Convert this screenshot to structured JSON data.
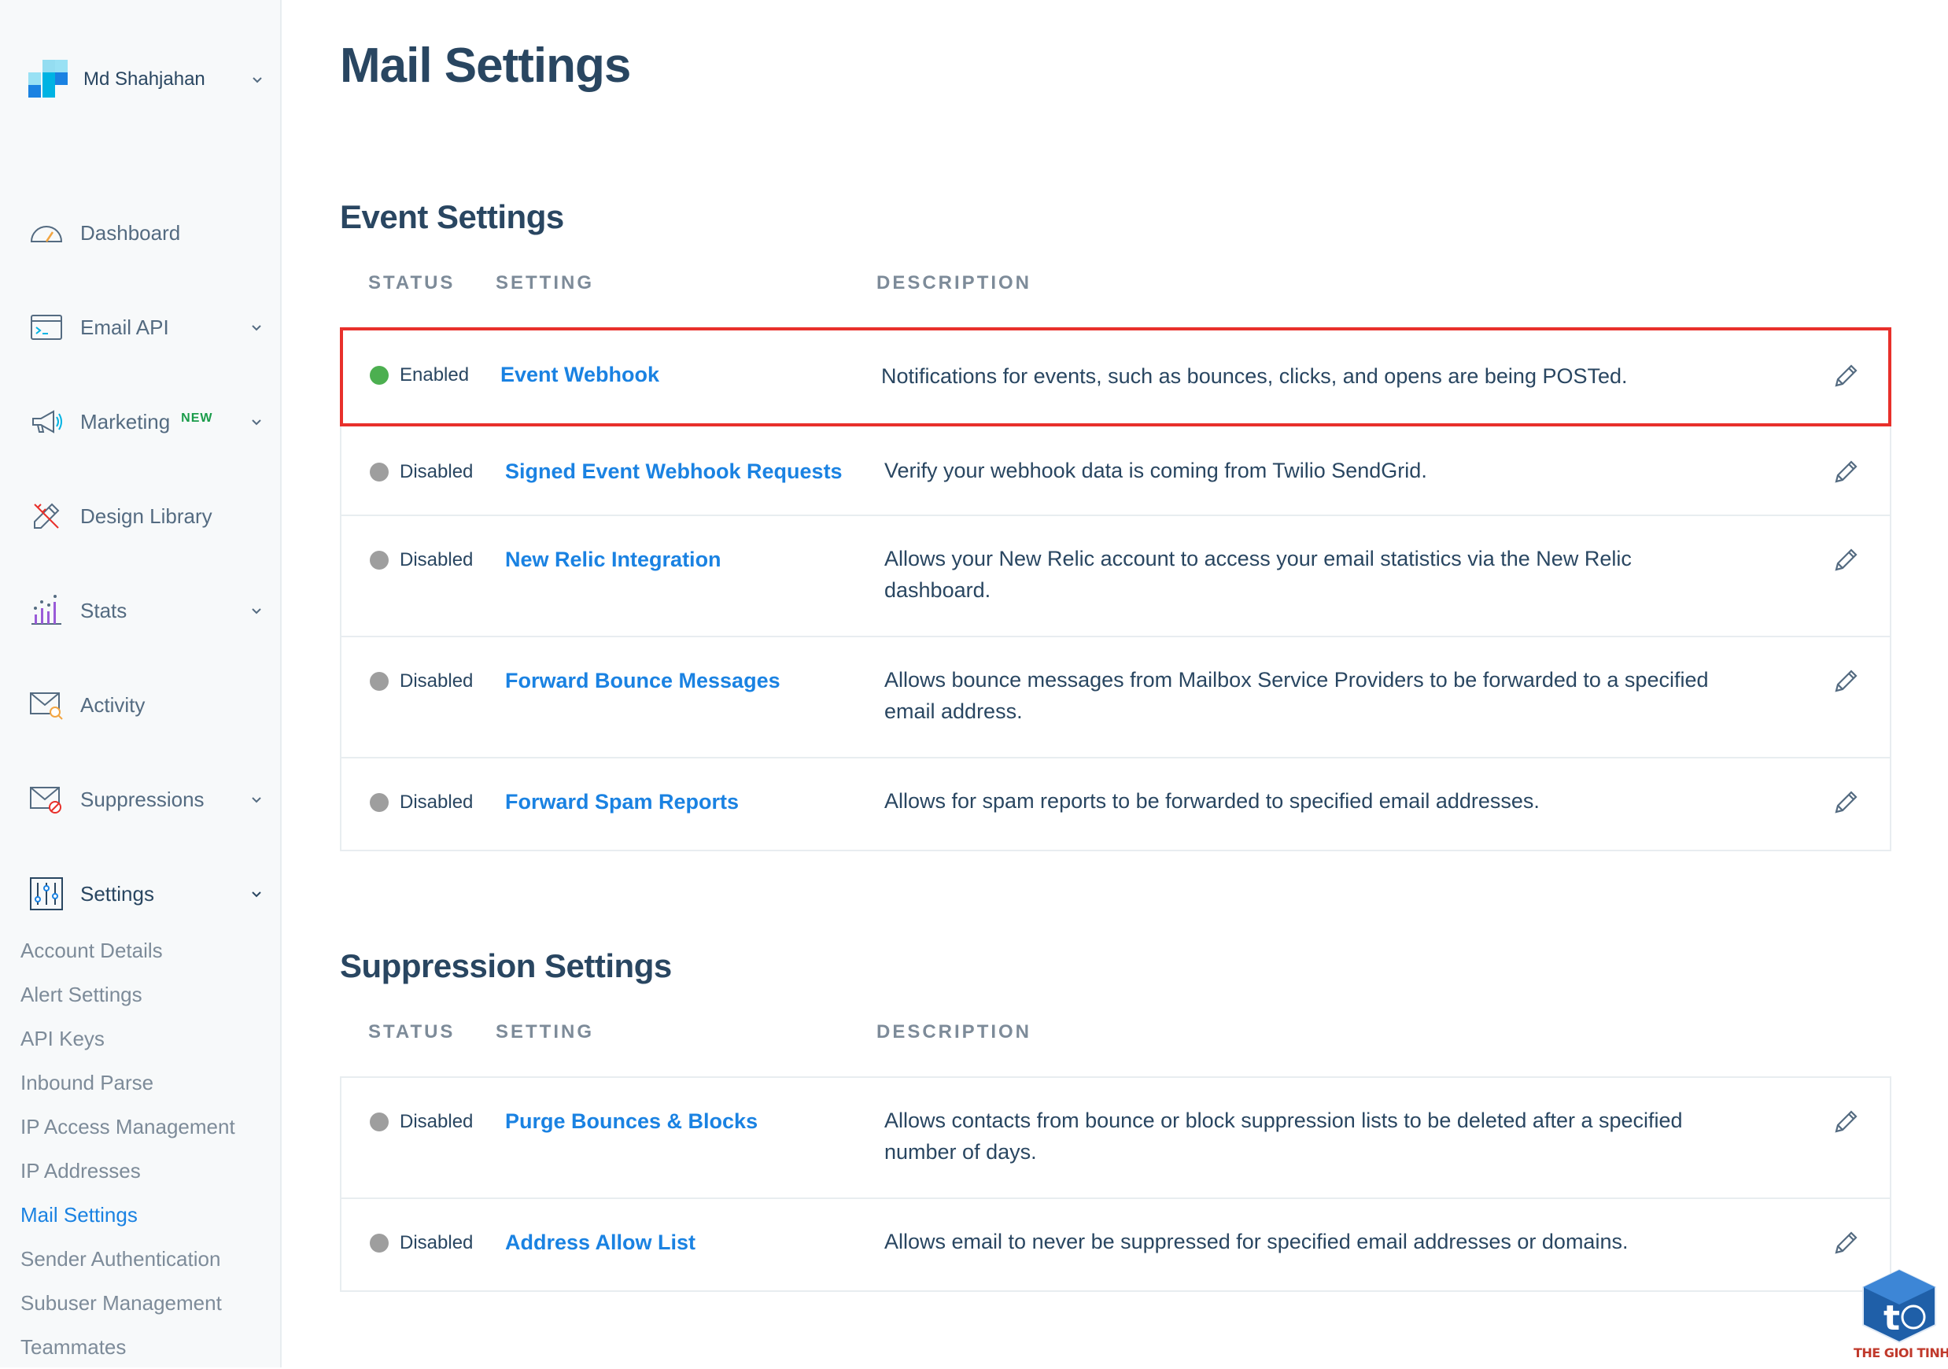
{
  "account": {
    "name": "Md Shahjahan"
  },
  "nav": [
    {
      "label": "Dashboard",
      "icon": "gauge-icon",
      "has_chevron": false
    },
    {
      "label": "Email API",
      "icon": "terminal-window-icon",
      "has_chevron": true
    },
    {
      "label": "Marketing",
      "badge": "NEW",
      "icon": "megaphone-icon",
      "has_chevron": true
    },
    {
      "label": "Design Library",
      "icon": "pencil-ruler-icon",
      "has_chevron": false
    },
    {
      "label": "Stats",
      "icon": "bar-chart-icon",
      "has_chevron": true
    },
    {
      "label": "Activity",
      "icon": "envelope-search-icon",
      "has_chevron": false
    },
    {
      "label": "Suppressions",
      "icon": "envelope-block-icon",
      "has_chevron": true
    },
    {
      "label": "Settings",
      "icon": "sliders-icon",
      "has_chevron": true
    }
  ],
  "settings_menu": [
    "Account Details",
    "Alert Settings",
    "API Keys",
    "Inbound Parse",
    "IP Access Management",
    "IP Addresses",
    "Mail Settings",
    "Sender Authentication",
    "Subuser Management",
    "Teammates"
  ],
  "settings_menu_active": "Mail Settings",
  "page": {
    "title": "Mail Settings"
  },
  "columns": {
    "status": "STATUS",
    "setting": "SETTING",
    "description": "DESCRIPTION"
  },
  "event_settings": {
    "title": "Event Settings",
    "rows": [
      {
        "status": "Enabled",
        "setting": "Event Webhook",
        "description": "Notifications for events, such as bounces, clicks, and opens are being POSTed."
      },
      {
        "status": "Disabled",
        "setting": "Signed Event Webhook Requests",
        "description": "Verify your webhook data is coming from Twilio SendGrid."
      },
      {
        "status": "Disabled",
        "setting": "New Relic Integration",
        "description": "Allows your New Relic account to access your email statistics via the New Relic dashboard."
      },
      {
        "status": "Disabled",
        "setting": "Forward Bounce Messages",
        "description": "Allows bounce messages from Mailbox Service Providers to be forwarded to a specified email address."
      },
      {
        "status": "Disabled",
        "setting": "Forward Spam Reports",
        "description": "Allows for spam reports to be forwarded to specified email addresses."
      }
    ]
  },
  "suppression_settings": {
    "title": "Suppression Settings",
    "rows": [
      {
        "status": "Disabled",
        "setting": "Purge Bounces & Blocks",
        "description": "Allows contacts from bounce or block suppression lists to be deleted after a specified number of days."
      },
      {
        "status": "Disabled",
        "setting": "Address Allow List",
        "description": "Allows email to never be suppressed for specified email addresses or domains."
      }
    ]
  },
  "colors": {
    "enabled": "#4caf50",
    "disabled": "#9e9e9e",
    "link": "#1a82e2",
    "highlight": "#e8302b",
    "heading": "#294661"
  },
  "watermark": {
    "text": "THE GIOI TINHOC"
  }
}
